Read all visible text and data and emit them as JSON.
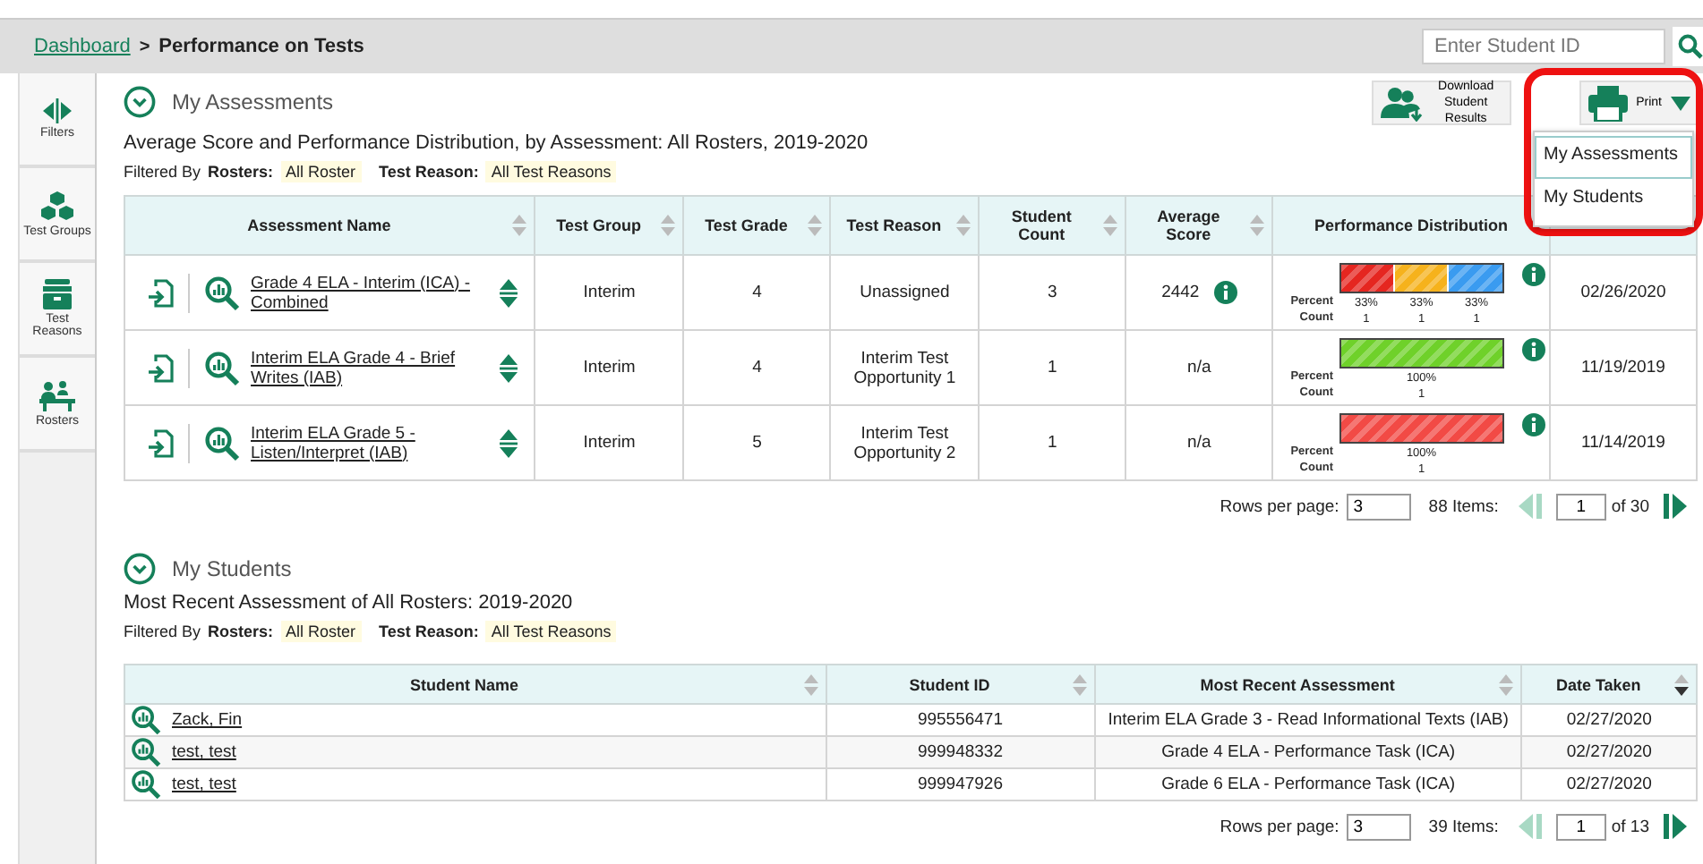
{
  "breadcrumb": {
    "link": "Dashboard",
    "separator": ">",
    "current": "Performance on Tests"
  },
  "student_search": {
    "placeholder": "Enter Student ID"
  },
  "sidebar": {
    "items": [
      {
        "label": "Filters",
        "kind": "filters"
      },
      {
        "label": "Test Groups",
        "kind": "groups"
      },
      {
        "label": "Test Reasons",
        "kind": "reasons"
      },
      {
        "label": "Rosters",
        "kind": "rosters"
      }
    ]
  },
  "assessments": {
    "title": "My Assessments",
    "expanded": true,
    "subtitle": "Average Score and Performance Distribution, by Assessment: All Rosters, 2019-2020",
    "filter": {
      "label": "Filtered By",
      "rosters_label": "Rosters:",
      "rosters": "All Roster",
      "reason_label": "Test Reason:",
      "reason": "All Test Reasons"
    },
    "download_button": "Download Student Results",
    "print": {
      "label": "Print",
      "expanded": true,
      "menu": [
        {
          "label": "My Assessments",
          "selected": true
        },
        {
          "label": "My Students",
          "selected": false
        }
      ]
    },
    "table": {
      "columns": [
        {
          "label": "Assessment Name",
          "sortable": true
        },
        {
          "label": "Test Group",
          "sortable": true
        },
        {
          "label": "Test Grade",
          "sortable": true
        },
        {
          "label": "Test Reason",
          "sortable": true
        },
        {
          "label": "Student Count",
          "sortable": true
        },
        {
          "label": "Average Score",
          "sortable": true
        },
        {
          "label": "Performance Distribution",
          "sortable": false
        },
        {
          "sortable": false
        }
      ],
      "rows": [
        {
          "name": "Grade 4 ELA - Interim (ICA) - Combined",
          "test_group": "Interim",
          "test_grade": "4",
          "test_reason": "Unassigned",
          "student_count": "3",
          "average_score": "2442",
          "score_info": true,
          "percent_label": "Percent",
          "count_label": "Count",
          "distribution": [
            {
              "color": "#e52620",
              "percent": "33%",
              "count": "1"
            },
            {
              "color": "#f6b21c",
              "percent": "33%",
              "count": "1"
            },
            {
              "color": "#3a9bf0",
              "percent": "33%",
              "count": "1"
            }
          ],
          "date": "02/26/2020"
        },
        {
          "name": "Interim ELA Grade 4 - Brief Writes (IAB)",
          "test_group": "Interim",
          "test_grade": "4",
          "test_reason": "Interim Test Opportunity 1",
          "student_count": "1",
          "average_score": "n/a",
          "score_info": false,
          "percent_label": "Percent",
          "count_label": "Count",
          "distribution": [
            {
              "color": "#6fd12a",
              "percent": "100%",
              "count": "1"
            }
          ],
          "date": "11/19/2019"
        },
        {
          "name": "Interim ELA Grade 5 - Listen/Interpret (IAB)",
          "test_group": "Interim",
          "test_grade": "5",
          "test_reason": "Interim Test Opportunity 2",
          "student_count": "1",
          "average_score": "n/a",
          "score_info": false,
          "percent_label": "Percent",
          "count_label": "Count",
          "distribution": [
            {
              "color": "#f24a45",
              "percent": "100%",
              "count": "1"
            }
          ],
          "date": "11/14/2019"
        }
      ]
    },
    "pager": {
      "rows_label": "Rows per page:",
      "rows_value": "3",
      "items": "88 Items:",
      "page": "1",
      "of": "of 30",
      "prev_disabled": true,
      "next_disabled": false
    }
  },
  "students": {
    "title": "My Students",
    "expanded": true,
    "subtitle": "Most Recent Assessment of All Rosters: 2019-2020",
    "filter": {
      "label": "Filtered By",
      "rosters_label": "Rosters:",
      "rosters": "All Roster",
      "reason_label": "Test Reason:",
      "reason": "All Test Reasons"
    },
    "table": {
      "columns": [
        {
          "label": "Student Name",
          "sorted": false
        },
        {
          "label": "Student ID",
          "sorted": false
        },
        {
          "label": "Most Recent Assessment",
          "sorted": false
        },
        {
          "label": "Date Taken",
          "sorted": true
        }
      ],
      "rows": [
        {
          "name": "Zack, Fin",
          "id": "995556471",
          "assessment": "Interim ELA Grade 3 - Read Informational Texts (IAB)",
          "date": "02/27/2020"
        },
        {
          "name": "test, test",
          "id": "999948332",
          "assessment": "Grade 4 ELA - Performance Task (ICA)",
          "date": "02/27/2020"
        },
        {
          "name": "test, test",
          "id": "999947926",
          "assessment": "Grade 6 ELA - Performance Task (ICA)",
          "date": "02/27/2020"
        }
      ]
    },
    "pager": {
      "rows_label": "Rows per page:",
      "rows_value": "3",
      "items": "39 Items:",
      "page": "1",
      "of": "of 13",
      "prev_disabled": true,
      "next_disabled": false
    }
  }
}
